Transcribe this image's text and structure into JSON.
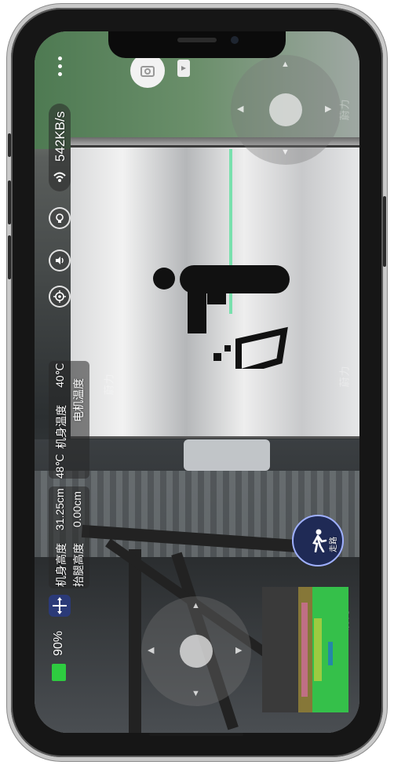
{
  "network": {
    "speed": "542KB/s"
  },
  "temperatures": {
    "body_label": "机身温度",
    "body_value": "40℃",
    "motor_label": "电机温度",
    "motor_value": "48℃"
  },
  "measurements": {
    "body_height_label": "机身高度",
    "body_height_value": "31.25cm",
    "lift_height_label": "抬腿高度",
    "lift_height_value": "0.00cm"
  },
  "battery": {
    "level": "90%",
    "fill_fraction": 0.9,
    "color": "#2ecc40"
  },
  "walk_button": {
    "label": "走路"
  },
  "watermark": {
    "text": "蔚力"
  },
  "icons": [
    "menu-dots-icon",
    "camera-icon",
    "wifi-icon",
    "light-bulb-icon",
    "speaker-icon",
    "target-icon",
    "battery-icon",
    "move-icon",
    "walk-icon"
  ],
  "colors": {
    "walk_button_bg": "#1f2a55",
    "accent": "#9fb0ff"
  }
}
